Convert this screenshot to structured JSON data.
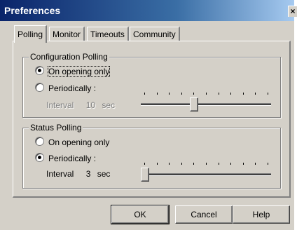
{
  "window": {
    "title": "Preferences",
    "close_glyph": "×"
  },
  "tabs": [
    {
      "label": "Polling",
      "active": true
    },
    {
      "label": "Monitor",
      "active": false
    },
    {
      "label": "Timeouts",
      "active": false
    },
    {
      "label": "Community",
      "active": false
    }
  ],
  "config_polling": {
    "label": "Configuration Polling",
    "options": [
      "On opening only",
      "Periodically :"
    ],
    "selected": 0,
    "interval_label": "Interval",
    "interval_value": "10",
    "interval_unit": "sec",
    "slider_level": 0.4
  },
  "status_polling": {
    "label": "Status Polling",
    "options": [
      "On opening only",
      "Periodically :"
    ],
    "selected": 1,
    "interval_label": "Interval",
    "interval_value": "3",
    "interval_unit": "sec",
    "slider_level": 0.0
  },
  "buttons": {
    "ok": "OK",
    "cancel": "Cancel",
    "help": "Help"
  }
}
